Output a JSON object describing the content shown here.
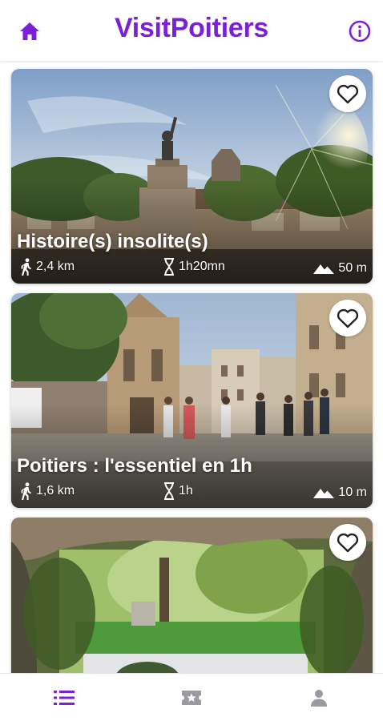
{
  "app": {
    "title": "VisitPoitiers",
    "accent_color": "#7b1fd9",
    "home_icon": "home-icon",
    "info_icon": "info-icon"
  },
  "tours": [
    {
      "title": "Histoire(s) insolite(s)",
      "distance": "2,4 km",
      "duration": "1h20mn",
      "elevation": "50 m",
      "favorite_icon": "heart-outline-icon"
    },
    {
      "title": "Poitiers : l'essentiel en 1h",
      "distance": "1,6 km",
      "duration": "1h",
      "elevation": "10 m",
      "favorite_icon": "heart-outline-icon"
    },
    {
      "title": "",
      "distance": "",
      "duration": "",
      "elevation": "",
      "favorite_icon": "heart-outline-icon"
    }
  ],
  "bottom_nav": {
    "items": [
      {
        "icon": "list-icon",
        "active": true
      },
      {
        "icon": "star-ticket-icon",
        "active": false
      },
      {
        "icon": "person-icon",
        "active": false
      }
    ],
    "active_color": "#7b1fd9",
    "inactive_color": "#9a9aa0"
  }
}
